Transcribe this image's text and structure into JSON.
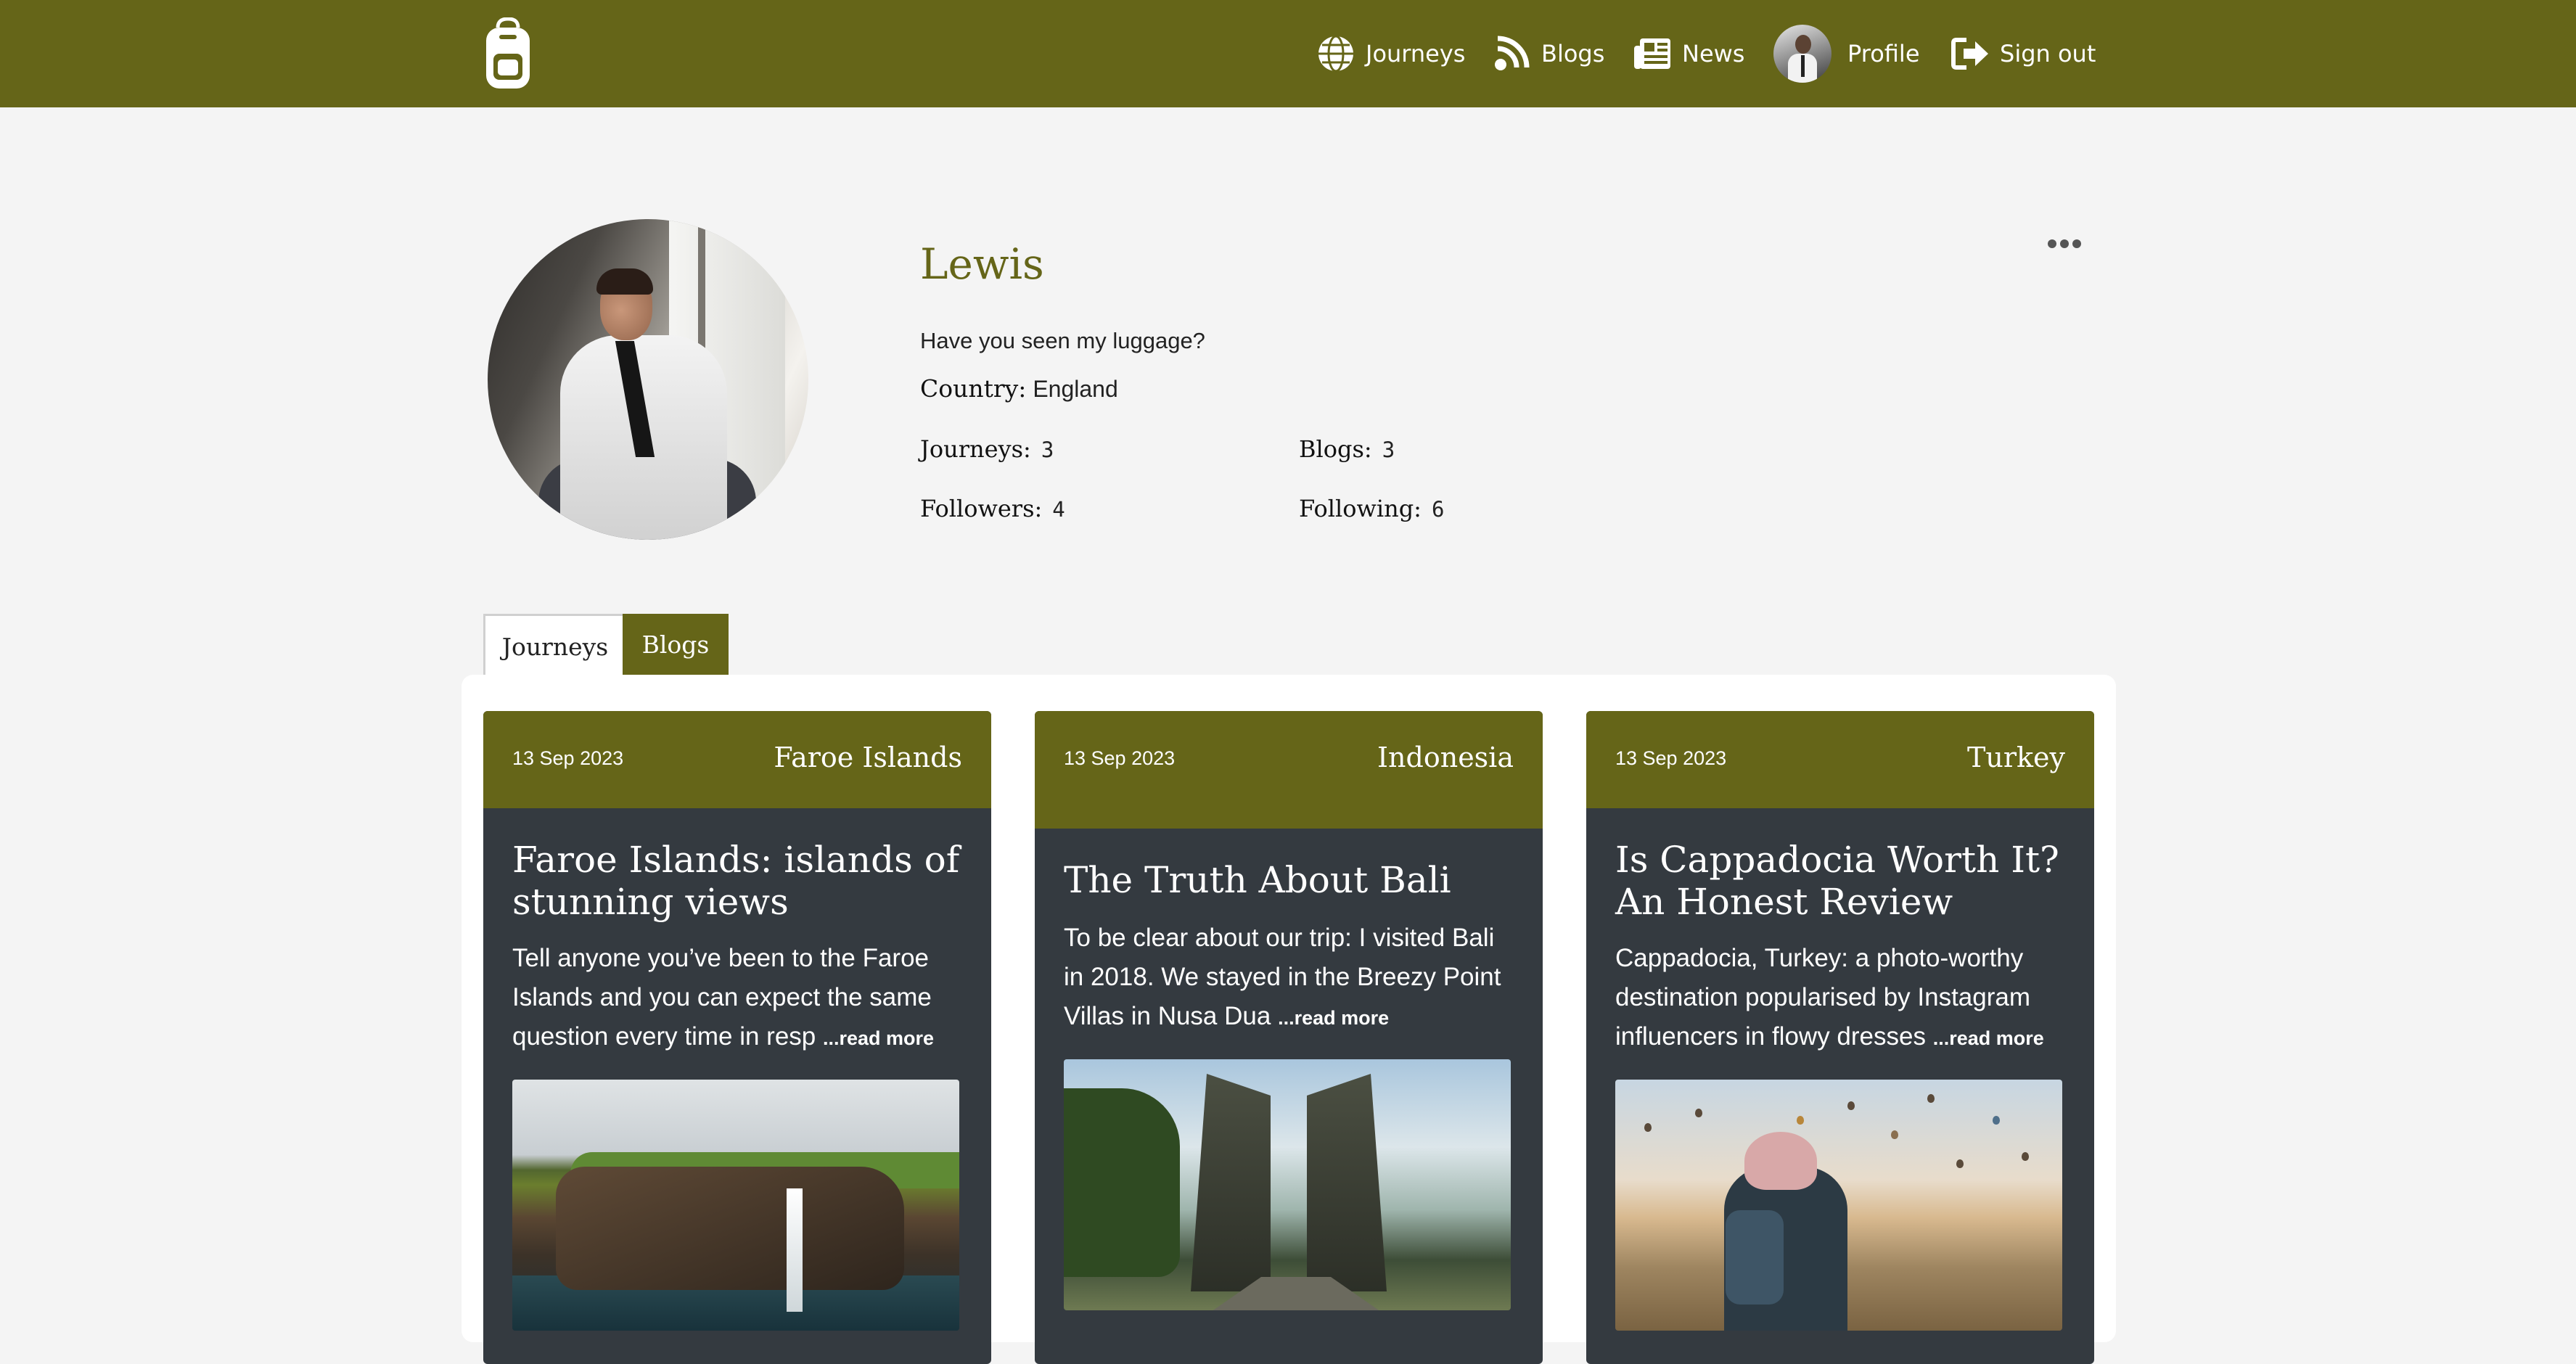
{
  "nav": {
    "items": [
      {
        "label": "Journeys",
        "icon": "globe-icon"
      },
      {
        "label": "Blogs",
        "icon": "rss-icon"
      },
      {
        "label": "News",
        "icon": "newspaper-icon"
      },
      {
        "label": "Profile",
        "icon": "avatar"
      },
      {
        "label": "Sign out",
        "icon": "sign-out-icon"
      }
    ]
  },
  "profile": {
    "name": "Lewis",
    "bio": "Have you seen my luggage?",
    "country_label": "Country:",
    "country": "England",
    "stats": [
      {
        "label": "Journeys:",
        "value": "3"
      },
      {
        "label": "Blogs:",
        "value": "3"
      },
      {
        "label": "Followers:",
        "value": "4"
      },
      {
        "label": "Following:",
        "value": "6"
      }
    ]
  },
  "tabs": [
    {
      "label": "Journeys",
      "active": true
    },
    {
      "label": "Blogs",
      "active": false
    }
  ],
  "cards": [
    {
      "date": "13 Sep 2023",
      "country": "Faroe Islands",
      "title": "Faroe Islands: islands of stunning views",
      "excerpt": "Tell anyone you’ve been to the Faroe Islands and you can expect the same question every time in resp",
      "read_more": "...read more"
    },
    {
      "date": "13 Sep 2023",
      "country": "Indonesia",
      "title": "The Truth About Bali",
      "excerpt": "To be clear about our trip: I visited Bali in 2018. We stayed in the Breezy Point Villas in Nusa Dua",
      "read_more": "...read more"
    },
    {
      "date": "13 Sep 2023",
      "country": "Turkey",
      "title": "Is Cappadocia Worth It? An Honest Review",
      "excerpt": "Cappadocia, Turkey: a photo-worthy destination popularised by Instagram influencers in flowy dresses",
      "read_more": "...read more"
    }
  ],
  "colors": {
    "brand_olive": "#656518",
    "card_dark": "#343a40",
    "background": "#f4f4f4"
  }
}
